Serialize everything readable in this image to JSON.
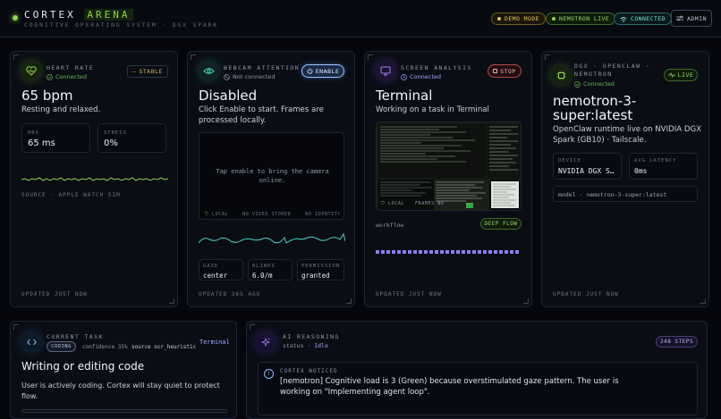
{
  "header": {
    "brand_main": "CORTEX",
    "brand_accent": "ARENA",
    "subtitle": "COGNITIVE OPERATING SYSTEM · DGX SPARK",
    "pills": {
      "demo": "DEMO MODE",
      "nemotron": "NEMOTRON LIVE",
      "connected": "CONNECTED"
    },
    "admin": "ADMIN"
  },
  "heart": {
    "title": "HEART RATE",
    "status": "Connected",
    "badge": "STABLE",
    "value": "65 bpm",
    "desc": "Resting and relaxed.",
    "hrv_label": "HRV",
    "hrv_value": "65 ms",
    "stress_label": "STRESS",
    "stress_value": "0%",
    "source": "SOURCE · APPLE WATCH SIM",
    "updated": "UPDATED JUST NOW"
  },
  "webcam": {
    "title": "WEBCAM ATTENTION",
    "status": "Not connected",
    "button": "ENABLE",
    "value": "Disabled",
    "desc": "Click Enable to start. Frames are processed locally.",
    "placeholder": "Tap enable to bring the camera online.",
    "tag_local": "LOCAL",
    "tag_video": "NO VIDEO STORED",
    "tag_identity": "NO IDENTITY",
    "gaze_label": "GAZE",
    "gaze_value": "center",
    "blinks_label": "BLINKS",
    "blinks_value": "6.0/m",
    "perm_label": "PERMISSION",
    "perm_value": "granted",
    "updated": "UPDATED 36S AGO"
  },
  "screen": {
    "title": "SCREEN ANALYSIS",
    "status": "Connected",
    "button": "STOP",
    "value": "Terminal",
    "desc": "Working on a task in Terminal",
    "tag_local": "LOCAL",
    "tag_frames": "FRAMES NO",
    "workflow": "workflow",
    "flow_badge": "DEEP FLOW",
    "updated": "UPDATED JUST NOW"
  },
  "dgx": {
    "title_line1": "DGX · OPENCLAW ·",
    "title_line2": "NEMOTRON",
    "status": "Connected",
    "badge": "LIVE",
    "value": "nemotron-3-super:latest",
    "desc": "OpenClaw runtime live on NVIDIA DGX Spark (GB10) · Tailscale.",
    "device_label": "DEVICE",
    "device_value": "NVIDIA DGX S…",
    "latency_label": "AVG LATENCY",
    "latency_value": "0ms",
    "model_line": "model · nemotron-3-super:latest",
    "updated": "UPDATED JUST NOW"
  },
  "task": {
    "title": "CURRENT TASK",
    "app": "Terminal",
    "category": "CODING",
    "confidence": "confidence 35%",
    "source": "source ocr_heuristic",
    "headline": "Writing or editing code",
    "desc": "User is actively coding. Cortex will stay quiet to protect flow."
  },
  "ai": {
    "title": "AI REASONING",
    "status_label": "status ·",
    "status_value": "Idle",
    "steps": "248 STEPS",
    "notice_title": "CORTEX NOTICED",
    "notice_text": "[nemotron] Cognitive load is 3 (Green) because overstimulated gaze pattern. The user is working on \"Implementing agent loop\"."
  },
  "colors": {
    "accent_green": "#8fd14f",
    "teal": "#4fd1c5",
    "purple": "#9b7cf5",
    "red": "#e05a5a",
    "yellow": "#d7b84a"
  }
}
